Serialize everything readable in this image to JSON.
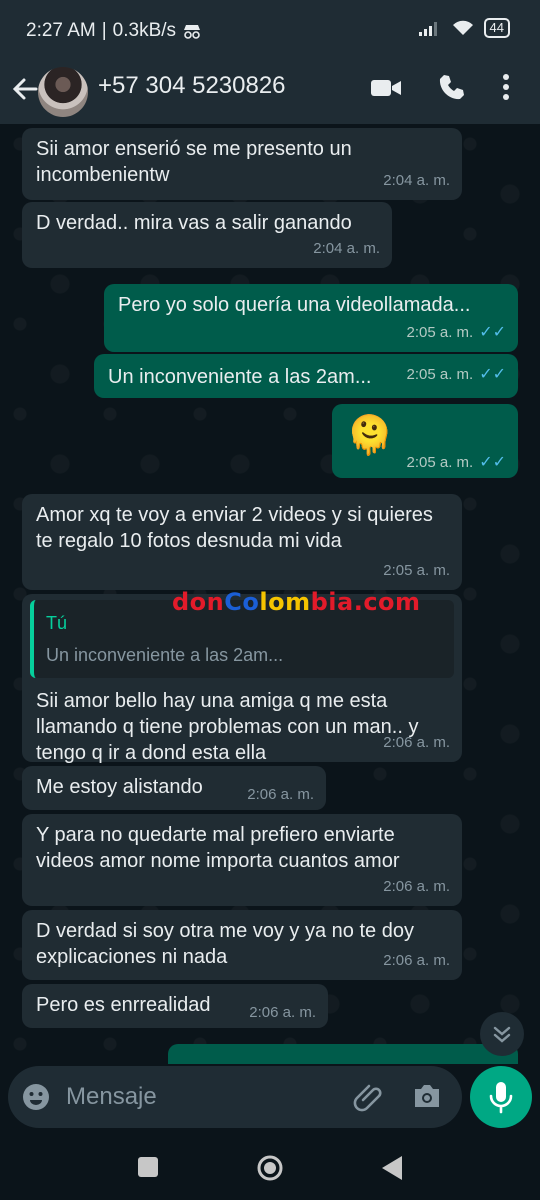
{
  "status_bar": {
    "time": "2:27 AM",
    "separator": "|",
    "speed": "0.3kB/s",
    "battery": "44"
  },
  "header": {
    "contact_name": "+57 304 5230826",
    "icons": [
      "back-arrow-icon",
      "avatar",
      "video-call-icon",
      "phone-icon",
      "more-vert-icon"
    ]
  },
  "messages": [
    {
      "dir": "in",
      "text": "Sii amor enserió se me presento un incombenientw",
      "time": "2:04 a. m."
    },
    {
      "dir": "in",
      "text": "D verdad.. mira vas a salir ganando",
      "time": "2:04 a. m."
    },
    {
      "dir": "out",
      "text": "Pero yo solo quería una videollamada...",
      "time": "2:05 a. m."
    },
    {
      "dir": "out",
      "text": "Un inconveniente a las 2am...",
      "time": "2:05 a. m."
    },
    {
      "dir": "out",
      "text": "🫠",
      "time": "2:05 a. m."
    },
    {
      "dir": "in",
      "text": "Amor xq te voy a enviar 2 videos y si quieres te regalo 10 fotos desnuda mi vida",
      "time": "2:05 a. m."
    },
    {
      "dir": "in",
      "quote_name": "Tú",
      "quote_text": "Un inconveniente a las 2am...",
      "text": "Sii amor bello hay una amiga q me esta llamando q tiene problemas con un man.. y tengo q ir a dond esta ella",
      "time": "2:06 a. m."
    },
    {
      "dir": "in",
      "text": "Me estoy alistando",
      "time": "2:06 a. m."
    },
    {
      "dir": "in",
      "text": "Y para no quedarte mal prefiero enviarte videos amor nome importa cuantos amor",
      "time": "2:06 a. m."
    },
    {
      "dir": "in",
      "text": "D verdad si soy otra me voy y ya no te doy explicaciones ni nada",
      "time": "2:06 a. m."
    },
    {
      "dir": "in",
      "text": "Pero es enrrealidad",
      "time": "2:06 a. m."
    }
  ],
  "watermark": {
    "p1": "don",
    "p2": "Co",
    "p3": "lom",
    "p4": "bia.com"
  },
  "input": {
    "placeholder": "Mensaje"
  },
  "colors": {
    "incoming": "#202c33",
    "outgoing": "#005c4b",
    "accent": "#00a884",
    "ticks": "#53bdeb"
  }
}
